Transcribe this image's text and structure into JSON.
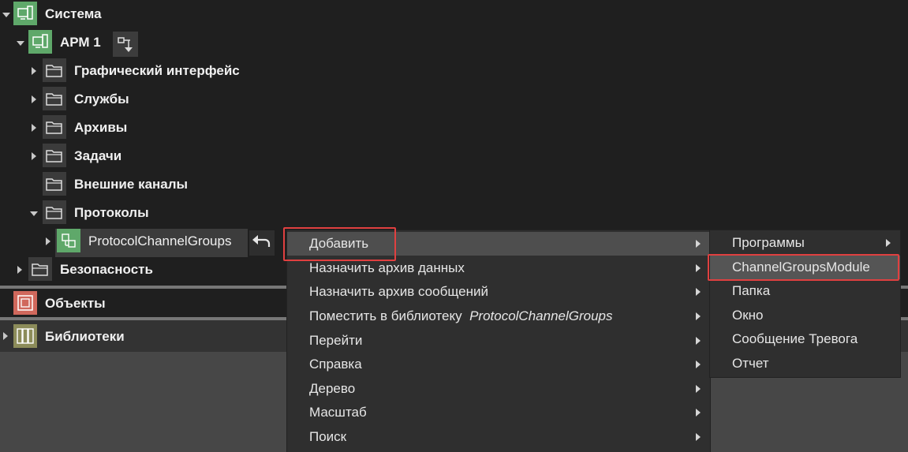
{
  "tree": {
    "root_label": "Система",
    "arm_label": "АРМ 1",
    "items": [
      {
        "label": "Графический интерфейс"
      },
      {
        "label": "Службы"
      },
      {
        "label": "Архивы"
      },
      {
        "label": "Задачи"
      },
      {
        "label": "Внешние каналы"
      },
      {
        "label": "Протоколы"
      }
    ],
    "selected_label": "ProtocolChannelGroups",
    "security_label": "Безопасность"
  },
  "sections": {
    "objects_label": "Объекты",
    "libraries_label": "Библиотеки"
  },
  "context_menu": {
    "items": [
      {
        "label": "Добавить"
      },
      {
        "label": "Назначить архив данных"
      },
      {
        "label": "Назначить архив сообщений"
      },
      {
        "label": "Поместить в библиотеку",
        "suffix": "ProtocolChannelGroups"
      },
      {
        "label": "Перейти"
      },
      {
        "label": "Справка"
      },
      {
        "label": "Дерево"
      },
      {
        "label": "Масштаб"
      },
      {
        "label": "Поиск"
      }
    ]
  },
  "submenu": {
    "items": [
      {
        "label": "Программы"
      },
      {
        "label": "ChannelGroupsModule"
      },
      {
        "label": "Папка"
      },
      {
        "label": "Окно"
      },
      {
        "label": "Сообщение Тревога"
      },
      {
        "label": "Отчет"
      }
    ]
  },
  "colors": {
    "highlight": "#e04040",
    "system_icon": "#5fa86a",
    "objects_icon": "#d0685c",
    "libraries_icon": "#8c8c5a"
  }
}
